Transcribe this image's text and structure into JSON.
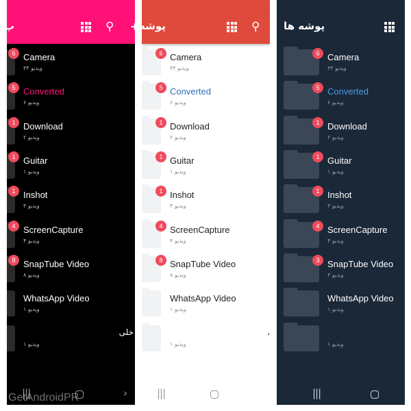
{
  "panels": [
    {
      "theme": "pink",
      "title": "پ",
      "status": "",
      "side_text": "خلی",
      "items": [
        {
          "name": "Camera",
          "badge": "6",
          "count": "۳۳ ویدیو"
        },
        {
          "name": "Converted",
          "badge": "5",
          "count": "۶ ویدیو"
        },
        {
          "name": "Download",
          "badge": "1",
          "count": "۲ ویدیو"
        },
        {
          "name": "Guitar",
          "badge": "1",
          "count": "۱ ویدیو"
        },
        {
          "name": "Inshot",
          "badge": "1",
          "count": "۳ ویدیو"
        },
        {
          "name": "ScreenCapture",
          "badge": "4",
          "count": "۴ ویدیو"
        },
        {
          "name": "SnapTube Video",
          "badge": "8",
          "count": "۸ ویدیو"
        },
        {
          "name": "WhatsApp Video",
          "badge": "",
          "count": "۱ ویدیو"
        },
        {
          "name": "",
          "badge": "",
          "count": "۱ ویدیو"
        }
      ]
    },
    {
      "theme": "red",
      "title": "پوشه",
      "status": "",
      "side_text": "،",
      "items": [
        {
          "name": "Camera",
          "badge": "6",
          "count": "۳۳ ویدیو"
        },
        {
          "name": "Converted",
          "badge": "5",
          "count": "۶ ویدیو"
        },
        {
          "name": "Download",
          "badge": "1",
          "count": "۲ ویدیو"
        },
        {
          "name": "Guitar",
          "badge": "1",
          "count": "۱ ویدیو"
        },
        {
          "name": "Inshot",
          "badge": "1",
          "count": "۳ ویدیو"
        },
        {
          "name": "ScreenCapture",
          "badge": "4",
          "count": "۴ ویدیو"
        },
        {
          "name": "SnapTube Video",
          "badge": "8",
          "count": "۸ ویدیو"
        },
        {
          "name": "WhatsApp Video",
          "badge": "",
          "count": "۱ ویدیو"
        },
        {
          "name": "",
          "badge": "",
          "count": "۱ ویدیو"
        }
      ]
    },
    {
      "theme": "dark",
      "title": "پوشه ها",
      "status": "",
      "side_text": "",
      "items": [
        {
          "name": "Camera",
          "badge": "6",
          "count": "۳۳ ویدیو"
        },
        {
          "name": "Converted",
          "badge": "5",
          "count": "۶ ویدیو"
        },
        {
          "name": "Download",
          "badge": "1",
          "count": "۲ ویدیو"
        },
        {
          "name": "Guitar",
          "badge": "1",
          "count": "۱ ویدیو"
        },
        {
          "name": "Inshot",
          "badge": "1",
          "count": "۳ ویدیو"
        },
        {
          "name": "ScreenCapture",
          "badge": "4",
          "count": "۴ ویدیو"
        },
        {
          "name": "SnapTube Video",
          "badge": "3",
          "count": "۳ ویدیو"
        },
        {
          "name": "WhatsApp Video",
          "badge": "",
          "count": "۱ ویدیو"
        },
        {
          "name": "",
          "badge": "",
          "count": "۱ ویدیو"
        }
      ]
    }
  ],
  "icons": {
    "grid": "grid-view-icon",
    "search": "search-icon",
    "recents": "recents-icon",
    "home": "home-icon",
    "back": "back-icon"
  },
  "colors": {
    "pink": "#ff1177",
    "red": "#e04a3c",
    "dark": "#1b2838",
    "badge": "#ef4b5c"
  },
  "watermark": "GetAndroidPR"
}
